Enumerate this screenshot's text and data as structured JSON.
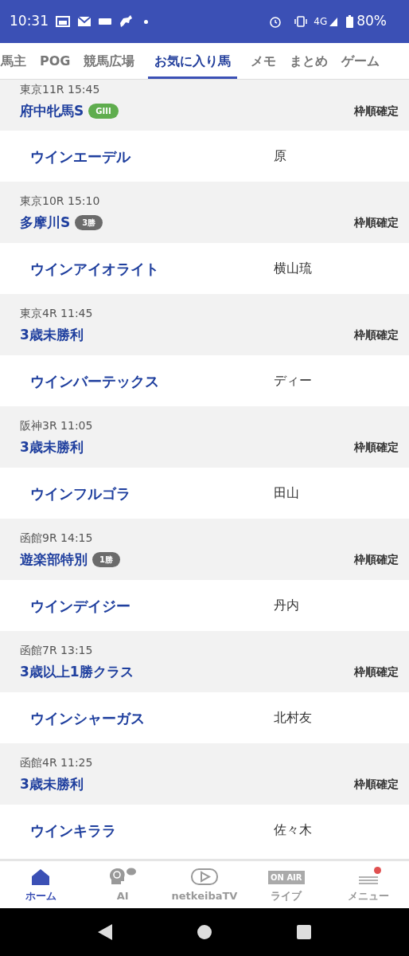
{
  "status_bar": {
    "time": "10:31",
    "network": "4G",
    "battery": "80%"
  },
  "tabs": [
    {
      "label": "馬主",
      "selected": false
    },
    {
      "label": "POG",
      "selected": false
    },
    {
      "label": "競馬広場",
      "selected": false
    },
    {
      "label": "お気に入り馬",
      "selected": true
    },
    {
      "label": "メモ",
      "selected": false
    },
    {
      "label": "まとめ",
      "selected": false
    },
    {
      "label": "ゲーム",
      "selected": false
    }
  ],
  "races": [
    {
      "meta": "東京11R 15:45",
      "name": "府中牝馬S",
      "badge": {
        "text": "GIII",
        "color": "#5fad4e"
      },
      "status": "枠順確定",
      "horse": "ウインエーデル",
      "jockey": "原"
    },
    {
      "meta": "東京10R 15:10",
      "name": "多摩川S",
      "badge": {
        "text": "3勝",
        "color": "#6b6b6b"
      },
      "status": "枠順確定",
      "horse": "ウインアイオライト",
      "jockey": "横山琉"
    },
    {
      "meta": "東京4R 11:45",
      "name": "3歳未勝利",
      "status": "枠順確定",
      "horse": "ウインバーテックス",
      "jockey": "ディー"
    },
    {
      "meta": "阪神3R 11:05",
      "name": "3歳未勝利",
      "status": "枠順確定",
      "horse": "ウインフルゴラ",
      "jockey": "田山"
    },
    {
      "meta": "函館9R 14:15",
      "name": "遊楽部特別",
      "badge": {
        "text": "1勝",
        "color": "#6b6b6b"
      },
      "status": "枠順確定",
      "horse": "ウインデイジー",
      "jockey": "丹内"
    },
    {
      "meta": "函館7R 13:15",
      "name": "3歳以上1勝クラス",
      "status": "枠順確定",
      "horse": "ウインシャーガス",
      "jockey": "北村友"
    },
    {
      "meta": "函館4R 11:25",
      "name": "3歳未勝利",
      "status": "枠順確定",
      "horse": "ウインキララ",
      "jockey": "佐々木"
    }
  ],
  "bottom_nav": [
    {
      "kind": "home",
      "label": "ホーム",
      "selected": true
    },
    {
      "kind": "ai",
      "label": "AI",
      "selected": false
    },
    {
      "kind": "tv",
      "label": "netkeibaTV",
      "selected": false
    },
    {
      "kind": "live",
      "label": "ライブ",
      "badge": "ON AIR",
      "selected": false
    },
    {
      "kind": "menu",
      "label": "メニュー",
      "selected": false,
      "notification": true
    }
  ]
}
